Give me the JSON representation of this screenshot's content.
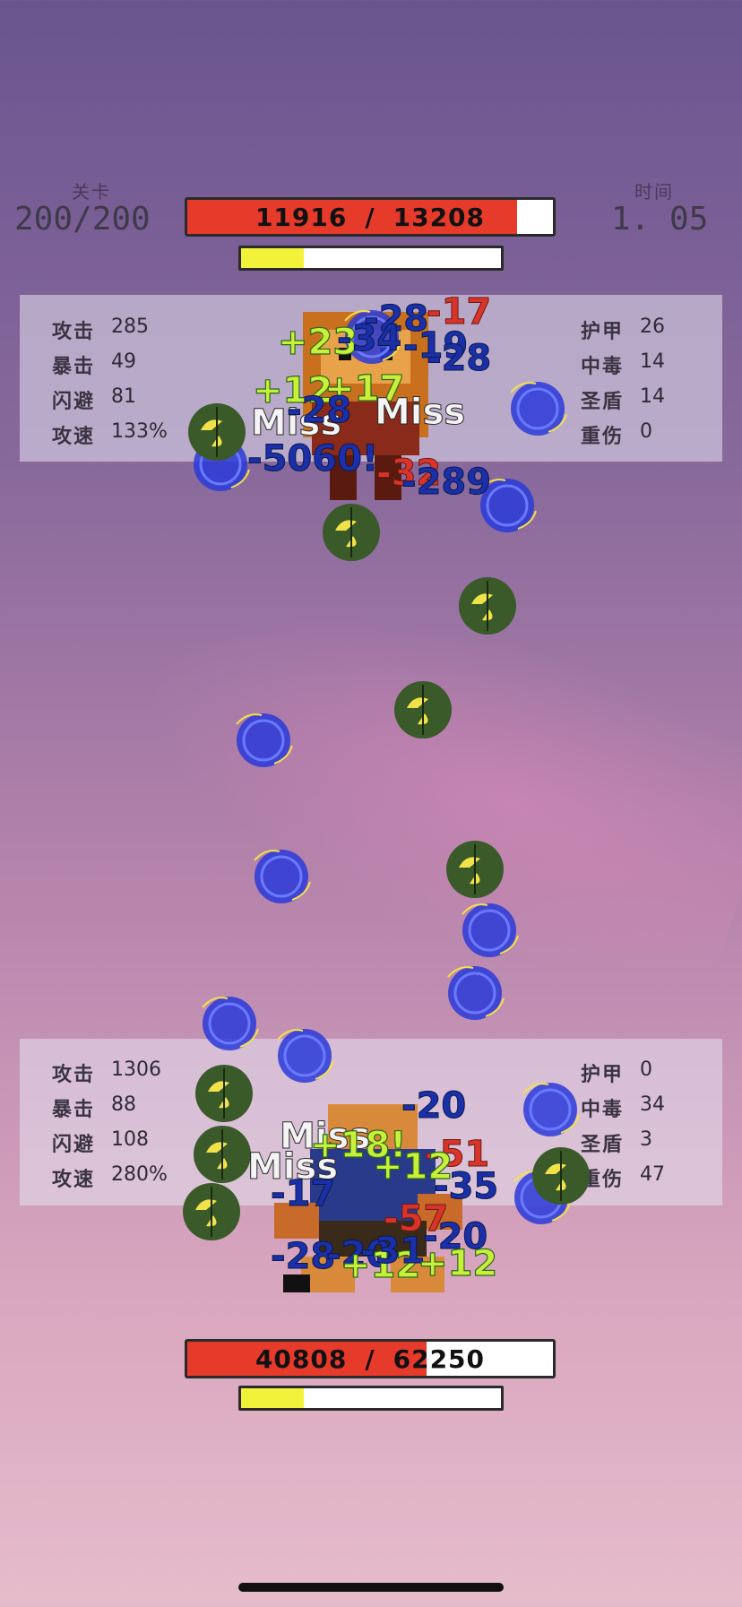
{
  "header": {
    "level_label": "关卡",
    "level_value": "200/200",
    "time_label": "时间",
    "time_value": "1. 05"
  },
  "enemy": {
    "hp_current": "11916",
    "hp_sep": "/",
    "hp_max": "13208",
    "hp_fraction": 0.9021,
    "energy_fraction": 0.24,
    "stats_left": [
      {
        "k": "攻击",
        "v": "285"
      },
      {
        "k": "暴击",
        "v": "49"
      },
      {
        "k": "闪避",
        "v": "81"
      },
      {
        "k": "攻速",
        "v": "133%"
      }
    ],
    "stats_right": [
      {
        "k": "护甲",
        "v": "26"
      },
      {
        "k": "中毒",
        "v": "14"
      },
      {
        "k": "圣盾",
        "v": "14"
      },
      {
        "k": "重伤",
        "v": "0"
      }
    ],
    "effects": [
      {
        "text": "-28",
        "color": "blue"
      },
      {
        "text": "-17",
        "color": "red"
      },
      {
        "text": "+23",
        "color": "green"
      },
      {
        "text": "-34",
        "color": "blue"
      },
      {
        "text": "-19",
        "color": "blue"
      },
      {
        "text": "-28",
        "color": "blue"
      },
      {
        "text": "+12",
        "color": "green"
      },
      {
        "text": "+17",
        "color": "green"
      },
      {
        "text": "Miss",
        "color": "white"
      },
      {
        "text": "-28",
        "color": "blue"
      },
      {
        "text": "Miss",
        "color": "white"
      },
      {
        "text": "-5060!",
        "color": "blue"
      },
      {
        "text": "-32",
        "color": "red"
      },
      {
        "text": "-289",
        "color": "blue"
      }
    ]
  },
  "player": {
    "hp_current": "40808",
    "hp_sep": "/",
    "hp_max": "62250",
    "hp_fraction": 0.6555,
    "energy_fraction": 0.24,
    "stats_left": [
      {
        "k": "攻击",
        "v": "1306"
      },
      {
        "k": "暴击",
        "v": "88"
      },
      {
        "k": "闪避",
        "v": "108"
      },
      {
        "k": "攻速",
        "v": "280%"
      }
    ],
    "stats_right": [
      {
        "k": "护甲",
        "v": "0"
      },
      {
        "k": "中毒",
        "v": "34"
      },
      {
        "k": "圣盾",
        "v": "3"
      },
      {
        "k": "重伤",
        "v": "47"
      }
    ],
    "effects": [
      {
        "text": "-20",
        "color": "blue"
      },
      {
        "text": "Miss",
        "color": "white"
      },
      {
        "text": "+18!",
        "color": "green"
      },
      {
        "text": "-51",
        "color": "red"
      },
      {
        "text": "Miss",
        "color": "white"
      },
      {
        "text": "+12",
        "color": "green"
      },
      {
        "text": "-35",
        "color": "blue"
      },
      {
        "text": "-17",
        "color": "blue"
      },
      {
        "text": "-57",
        "color": "red"
      },
      {
        "text": "-20",
        "color": "blue"
      },
      {
        "text": "-28",
        "color": "blue"
      },
      {
        "text": "-20",
        "color": "blue"
      },
      {
        "text": "+12",
        "color": "green"
      },
      {
        "text": "-31",
        "color": "blue"
      },
      {
        "text": "+12",
        "color": "green"
      }
    ]
  },
  "colors": {
    "hp_fill": "#e63a2a",
    "energy_fill": "#f2f23a",
    "blue_orb": "#2a3ad8",
    "green_orb": "#3a5a2a"
  },
  "icons": [
    "blue-energy-orb-icon",
    "green-poison-orb-icon"
  ]
}
